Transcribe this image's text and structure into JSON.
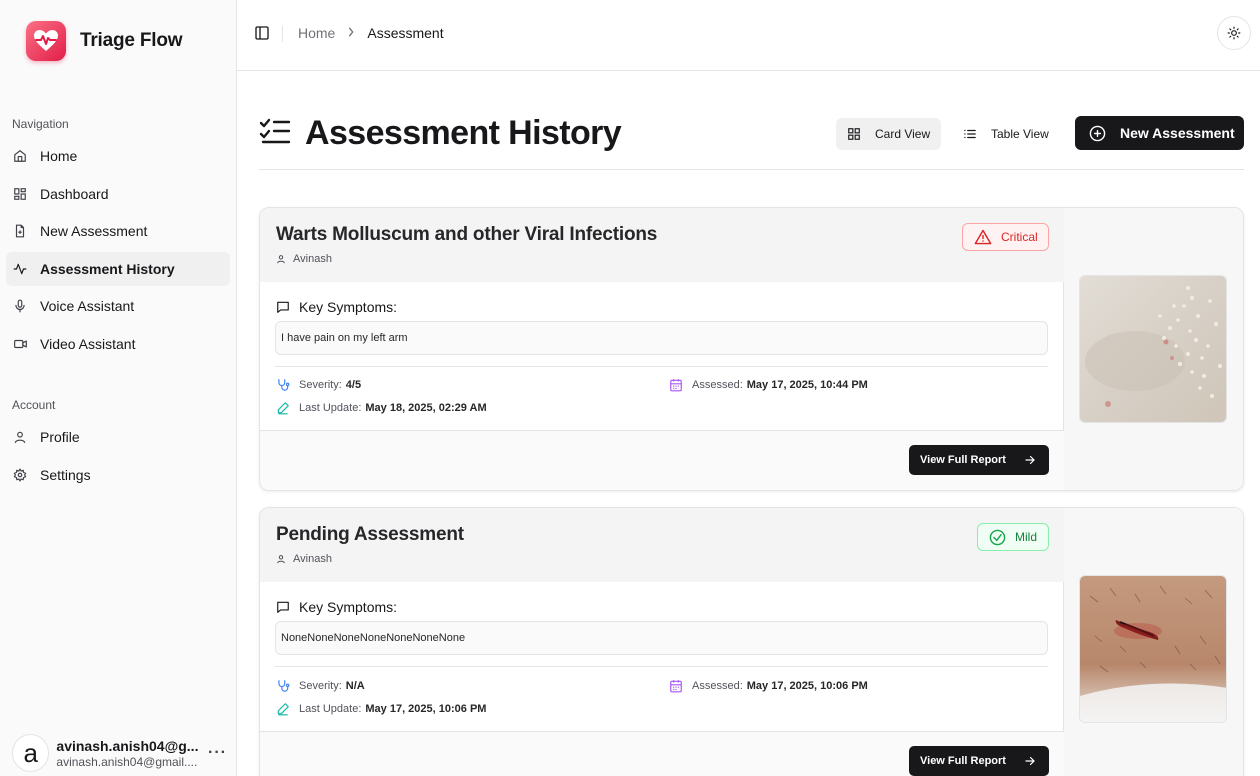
{
  "app": {
    "name": "Triage Flow"
  },
  "sidebar": {
    "nav_label": "Navigation",
    "nav_items": [
      {
        "label": "Home",
        "icon": "home-icon"
      },
      {
        "label": "Dashboard",
        "icon": "dashboard-icon"
      },
      {
        "label": "New Assessment",
        "icon": "file-plus-icon"
      },
      {
        "label": "Assessment History",
        "icon": "activity-icon",
        "active": true
      },
      {
        "label": "Voice Assistant",
        "icon": "mic-icon"
      },
      {
        "label": "Video Assistant",
        "icon": "video-icon"
      }
    ],
    "account_label": "Account",
    "account_items": [
      {
        "label": "Profile",
        "icon": "user-icon"
      },
      {
        "label": "Settings",
        "icon": "gear-icon"
      }
    ],
    "user": {
      "avatar_letter": "a",
      "name": "avinash.anish04@g...",
      "email": "avinash.anish04@gmail...."
    }
  },
  "topbar": {
    "breadcrumb": [
      "Home",
      "Assessment"
    ]
  },
  "page": {
    "title": "Assessment History",
    "card_view_label": "Card View",
    "table_view_label": "Table View",
    "new_assessment_label": "New Assessment"
  },
  "assessments": [
    {
      "title": "Warts Molluscum and other Viral Infections",
      "author": "Avinash",
      "badge": "Critical",
      "symptoms_label": "Key Symptoms:",
      "symptoms": "I have pain on my left arm",
      "severity_label": "Severity:",
      "severity": "4/5",
      "assessed_label": "Assessed:",
      "assessed": "May 17, 2025, 10:44 PM",
      "updated_label": "Last Update:",
      "updated": "May 18, 2025, 02:29 AM",
      "report_label": "View Full Report"
    },
    {
      "title": "Pending Assessment",
      "author": "Avinash",
      "badge": "Mild",
      "symptoms_label": "Key Symptoms:",
      "symptoms": "NoneNoneNoneNoneNoneNoneNone",
      "severity_label": "Severity:",
      "severity": "N/A",
      "assessed_label": "Assessed:",
      "assessed": "May 17, 2025, 10:06 PM",
      "updated_label": "Last Update:",
      "updated": "May 17, 2025, 10:06 PM",
      "report_label": "View Full Report"
    }
  ],
  "colors": {
    "primary": "#18181b",
    "brand": "#f43f5e",
    "critical": "#dc2626",
    "mild": "#16a34a",
    "severity_icon": "#3b82f6",
    "assessed_icon": "#a855f7",
    "update_icon": "#14b8a6"
  }
}
